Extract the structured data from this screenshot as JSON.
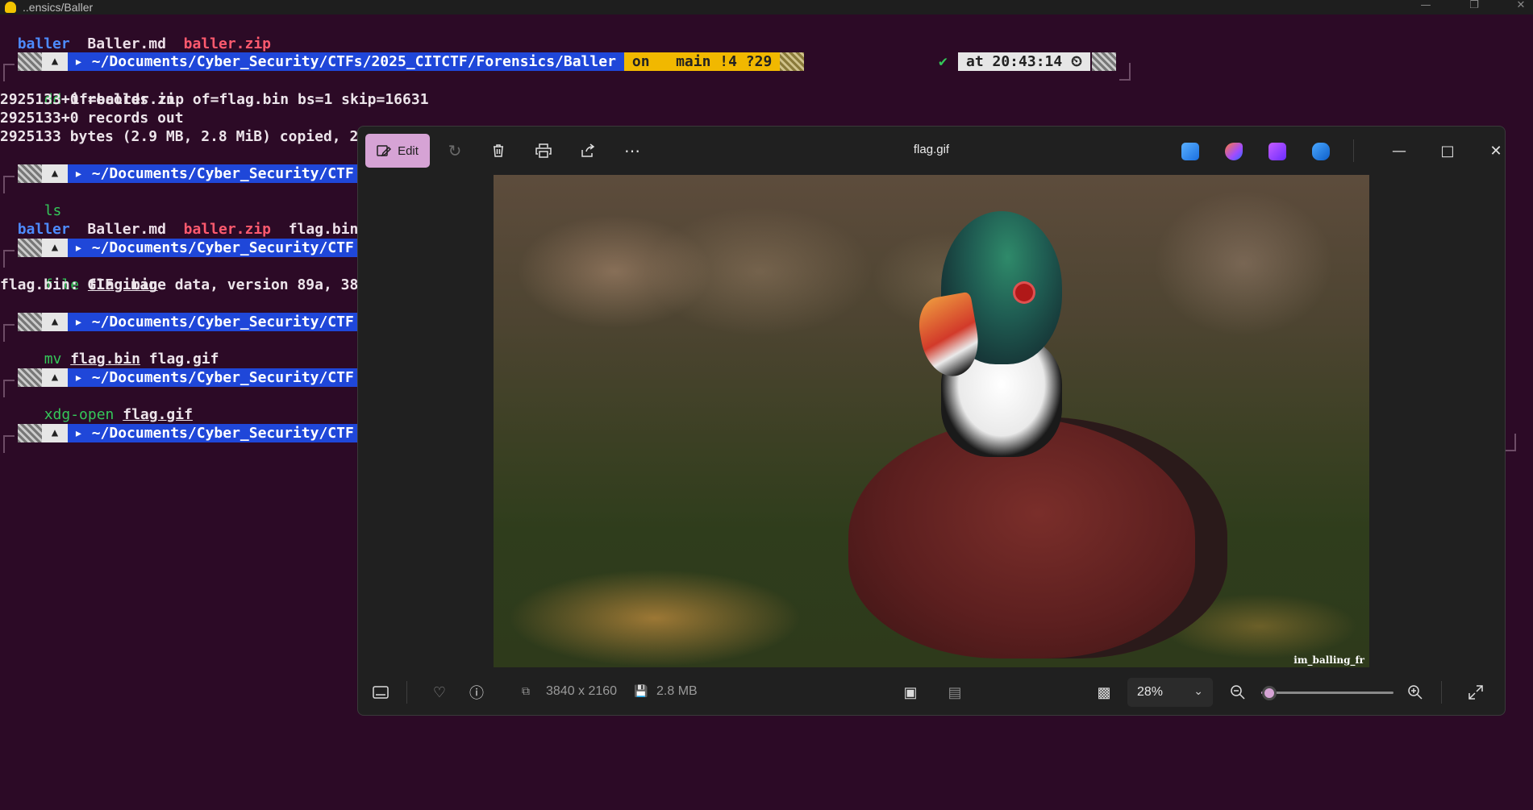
{
  "terminal": {
    "title": "..ensics/Baller",
    "ls1": [
      "baller",
      "Baller.md",
      "baller.zip"
    ],
    "prompt_path_full": "~/Documents/Cyber_Security/CTFs/2025_CITCTF/Forensics/Baller",
    "prompt_path_short": "~/Documents/Cyber_Security/CTF",
    "git": "on   main !4 ?29",
    "checkmark": "✔",
    "time": "at 20:43:14 ⏲",
    "dd_cmd": "dd",
    "dd_args": "if=baller.zip of=flag.bin bs=1 skip=16631",
    "dd_out1": "2925133+0 records in",
    "dd_out2": "2925133+0 records out",
    "dd_out3": "2925133 bytes (2.9 MB, 2.8 MiB) copied, 2",
    "ls_cmd": "ls",
    "ls2": [
      "baller",
      "Baller.md",
      "baller.zip",
      "flag.bin"
    ],
    "file_cmd": "file",
    "file_arg": "flag.bin",
    "file_out": "flag.bin: GIF image data, version 89a, 38",
    "mv_cmd": "mv",
    "mv_arg1": "flag.bin",
    "mv_arg2": "flag.gif",
    "xdg_cmd": "xdg-open",
    "xdg_arg": "flag.gif"
  },
  "viewer": {
    "edit_label": "Edit",
    "title": "flag.gif",
    "watermark": "im_balling_fr",
    "dimensions": "3840 x 2160",
    "size": "2.8 MB",
    "zoom": "28%",
    "zoom_fraction": 0.06
  },
  "colors": {
    "accent": "#d6a3d5",
    "terminal_bg": "#2c0a26",
    "path_segment": "#1f47d9",
    "git_segment": "#f1b800"
  }
}
